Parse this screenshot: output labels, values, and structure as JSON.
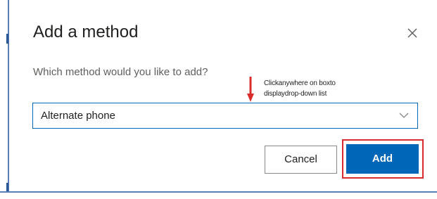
{
  "dialog": {
    "title": "Add a method",
    "question": "Which method would you like to add?",
    "select": {
      "value": "Alternate phone"
    },
    "buttons": {
      "cancel_label": "Cancel",
      "add_label": "Add"
    }
  },
  "annotation": {
    "line1": "Clickanywhere on boxto",
    "line2": "displaydrop-down list",
    "arrow_color": "#d92d2d",
    "highlight_color": "#d92d2d"
  },
  "colors": {
    "accent": "#0067b8",
    "title_text": "#201f1e",
    "secondary_text": "#605e5c"
  },
  "icons": {
    "close": "close-icon",
    "chevron": "chevron-down-icon",
    "arrow": "arrow-down-icon"
  }
}
